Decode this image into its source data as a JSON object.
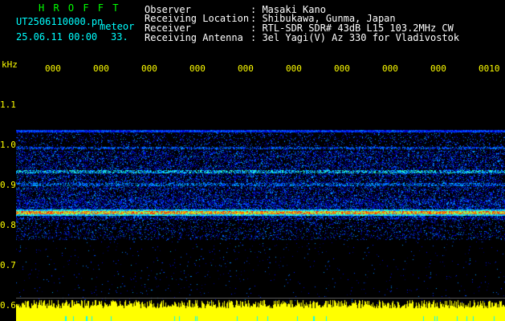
{
  "logo": "H R O F F T",
  "file_name": "UT2506110000.pn",
  "meteor_label": "meteor",
  "datetime": "25.06.11 00:00",
  "count": "33.",
  "info": [
    {
      "label": "Observer",
      "value": ": Masaki Kano"
    },
    {
      "label": "Receiving Location",
      "value": ": Shibukawa, Gunma, Japan"
    },
    {
      "label": "Receiver",
      "value": ": RTL-SDR SDR# 43dB L15 103.2MHz CW"
    },
    {
      "label": "Receiving Antenna",
      "value": ": 3el Yagi(V) Az 330 for Vladivostok"
    }
  ],
  "axis": {
    "unit": "kHz",
    "y_ticks": [
      "1.1",
      "1.0",
      "0.9",
      "0.8",
      "0.7",
      "0.6"
    ],
    "x_ticks": [
      "000",
      "000",
      "000",
      "000",
      "000",
      "000",
      "000",
      "000",
      "000",
      "0010"
    ]
  },
  "colors": {
    "header_cyan": "#00ffff",
    "axis_yellow": "#ffff00",
    "logo_green": "#00ff00",
    "info_white": "#ffffff"
  }
}
